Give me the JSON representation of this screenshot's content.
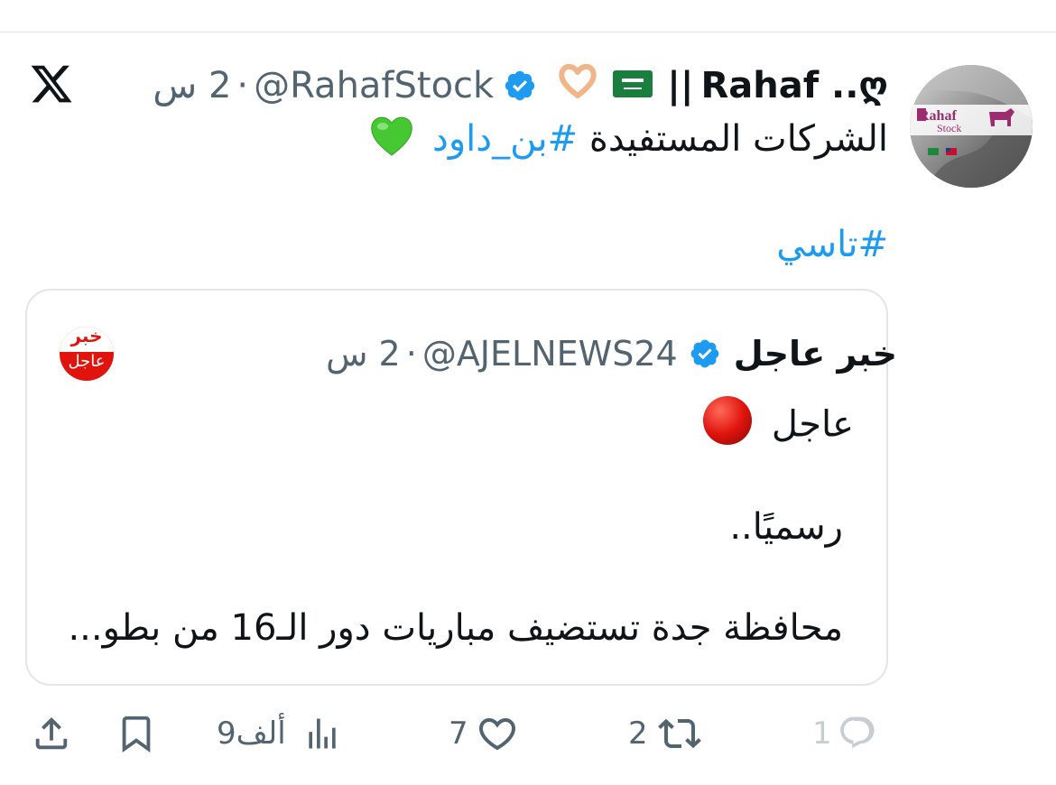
{
  "tweet": {
    "author_name": "Rahaf ..ღ",
    "author_flag": "🇸🇦",
    "author_emoji": "🫶🏼",
    "author_separator": "||",
    "handle": "@RahafStock",
    "time": "2 س",
    "dot": "·",
    "line1_text": "الشركات المستفيدة",
    "line1_hashtag": "#بن_داود",
    "line1_emoji": "💚",
    "hashtag2": "#تاسي",
    "avatar_text_main": "Rahaf",
    "avatar_text_sub": "Stock"
  },
  "quote": {
    "author_name": "خبر عاجل",
    "handle": "@AJELNEWS24",
    "time": "2 س",
    "dot": "·",
    "avatar_top": "خبر",
    "avatar_bottom": "عاجل",
    "line1": "عاجل",
    "line2": "رسميًا..",
    "line3": "محافظة جدة تستضيف مباريات دور الـ16 من بطو..."
  },
  "actions": {
    "replies": "1",
    "retweets": "2",
    "likes": "7",
    "views": "9ألف"
  },
  "colors": {
    "accent": "#1d9bf0",
    "text": "#0f1419",
    "muted": "#536471",
    "badge": "#1d9bf0",
    "news_red": "#e0140d"
  },
  "icons": [
    "x-logo-icon",
    "verified-badge-icon",
    "reply-icon",
    "retweet-icon",
    "like-icon",
    "views-icon",
    "bookmark-icon",
    "share-icon",
    "red-circle-icon",
    "green-heart-icon"
  ]
}
